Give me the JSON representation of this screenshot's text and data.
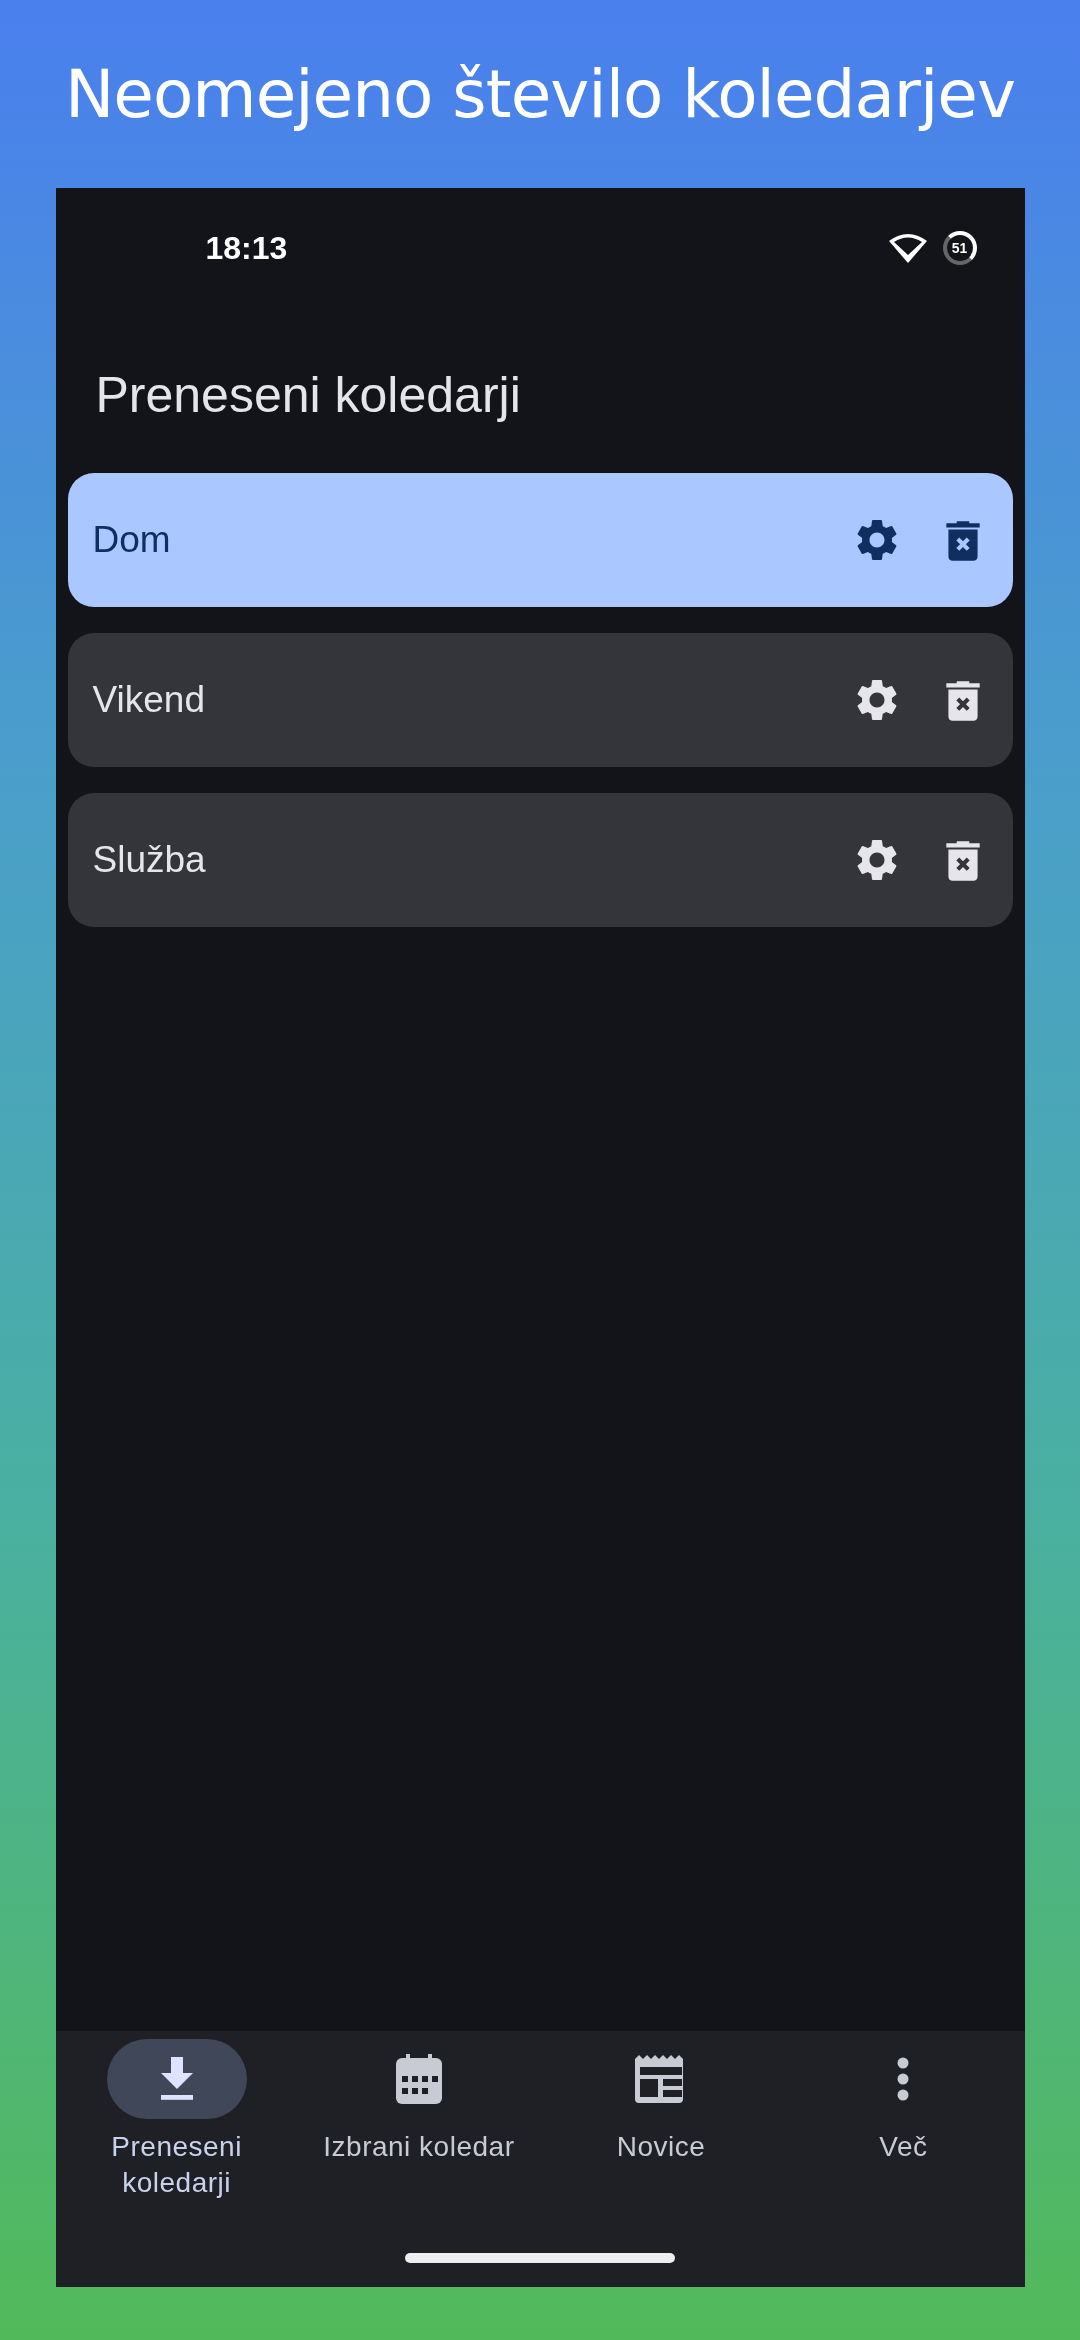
{
  "banner": {
    "title": "Neomejeno število koledarjev"
  },
  "status_bar": {
    "time": "18:13",
    "battery": "51"
  },
  "header": {
    "title": "Preneseni koledarji"
  },
  "calendars": [
    {
      "name": "Dom",
      "selected": true
    },
    {
      "name": "Vikend",
      "selected": false
    },
    {
      "name": "Služba",
      "selected": false
    }
  ],
  "bottom_nav": [
    {
      "kind": "download",
      "label": "Preneseni koledarji",
      "selected": true
    },
    {
      "kind": "calendar",
      "label": "Izbrani koledar",
      "selected": false
    },
    {
      "kind": "news",
      "label": "Novice",
      "selected": false
    },
    {
      "kind": "more",
      "label": "Več",
      "selected": false
    }
  ]
}
